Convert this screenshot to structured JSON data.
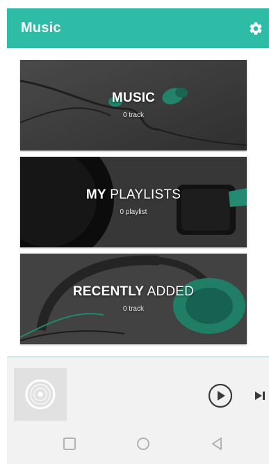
{
  "app": {
    "title": "Music"
  },
  "appbar": {
    "title": "Music",
    "settings_icon": "gear-icon",
    "background_color": "#2ebca6"
  },
  "cards": [
    {
      "id": "music",
      "title_bold": "MUSIC",
      "title_light": "",
      "subtitle": "0 track",
      "accent_color": "#2a9f82"
    },
    {
      "id": "my-playlists",
      "title_bold": "MY",
      "title_light": " PLAYLISTS",
      "subtitle": "0 playlist",
      "accent_color": "#2a9f82"
    },
    {
      "id": "recently-added",
      "title_bold": "RECENTLY",
      "title_light": " ADDED",
      "subtitle": "0 track",
      "accent_color": "#2a9f82"
    }
  ],
  "player": {
    "album_art_icon": "vinyl-disc-icon",
    "play_icon": "play-circle-icon",
    "next_icon": "skip-next-icon"
  },
  "navigation_bar": {
    "recent_icon": "square-recents-icon",
    "home_icon": "circle-home-icon",
    "back_icon": "triangle-back-icon"
  }
}
